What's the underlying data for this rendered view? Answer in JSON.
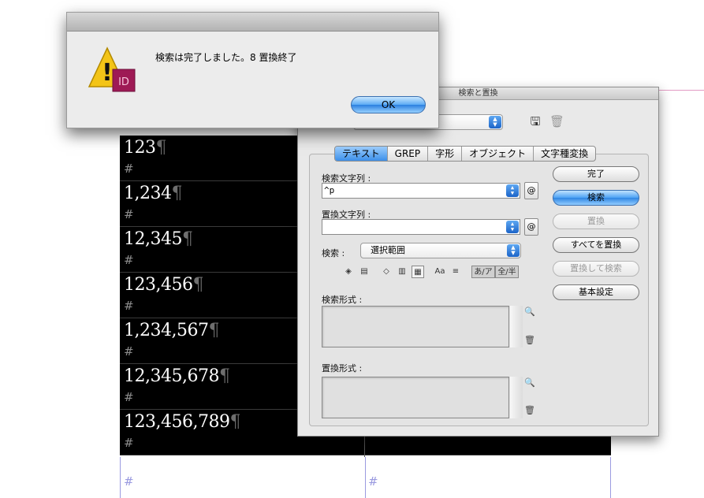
{
  "document": {
    "rows": [
      {
        "number": "123",
        "pilcrow": "¶",
        "hash": "#"
      },
      {
        "number": "1,234",
        "pilcrow": "¶",
        "hash": "#"
      },
      {
        "number": "12,345",
        "pilcrow": "¶",
        "hash": "#"
      },
      {
        "number": "123,456",
        "pilcrow": "¶",
        "hash": "#"
      },
      {
        "number": "1,234,567",
        "pilcrow": "¶",
        "hash": "#"
      },
      {
        "number": "12,345,678",
        "pilcrow": "¶",
        "hash": "#"
      },
      {
        "number": "123,456,789",
        "pilcrow": "¶",
        "hash": "#"
      }
    ],
    "empty_cells": [
      "#",
      "#"
    ]
  },
  "alert": {
    "message": "検索は完了しました。8 置換終了",
    "ok_label": "OK",
    "app_badge": "ID",
    "warning_glyph": "!",
    "colors": {
      "warning": "#f3c417",
      "badge": "#9e1a55"
    }
  },
  "find_change": {
    "title": "検索と置換",
    "tabs": [
      "テキスト",
      "GREP",
      "字形",
      "オブジェクト",
      "文字種変換"
    ],
    "active_tab": "テキスト",
    "find_label": "検索文字列 :",
    "find_value": "^p",
    "change_label": "置換文字列 :",
    "change_value": "",
    "search_label": "検索 :",
    "search_scope": "選択範囲",
    "options": [
      "あ/ア",
      "全/半"
    ],
    "find_format_label": "検索形式 :",
    "change_format_label": "置換形式 :",
    "buttons": {
      "done": "完了",
      "find": "検索",
      "change": "置換",
      "change_all": "すべてを置換",
      "change_find": "置換して検索",
      "fewer_options": "基本設定"
    },
    "at_label": "@",
    "accent": "#3c8fe9"
  }
}
